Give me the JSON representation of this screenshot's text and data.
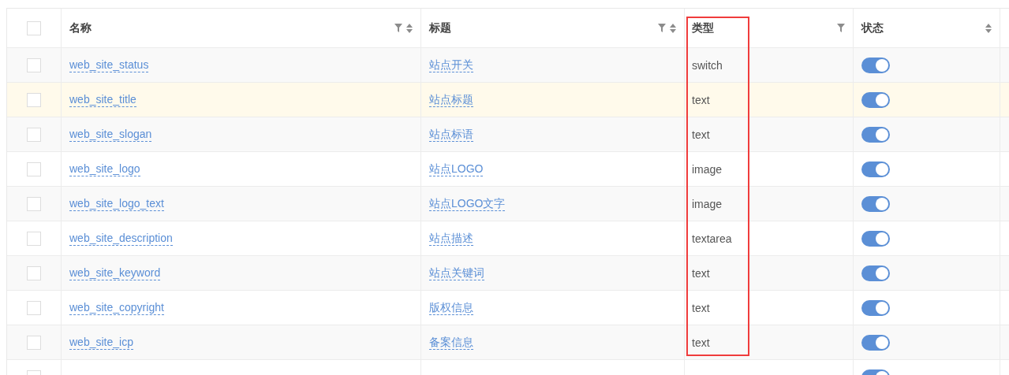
{
  "table": {
    "columns": [
      {
        "label": "名称",
        "filter": true,
        "sort": true,
        "highlighted": false
      },
      {
        "label": "标题",
        "filter": true,
        "sort": true,
        "highlighted": false
      },
      {
        "label": "类型",
        "filter": true,
        "sort": false,
        "highlighted": true
      },
      {
        "label": "状态",
        "filter": false,
        "sort": true,
        "highlighted": false
      }
    ],
    "rows": [
      {
        "checked": false,
        "hovered": false,
        "name": "web_site_status",
        "title": "站点开关",
        "type": "switch",
        "on": true
      },
      {
        "checked": false,
        "hovered": true,
        "name": "web_site_title",
        "title": "站点标题",
        "type": "text",
        "on": true
      },
      {
        "checked": false,
        "hovered": false,
        "name": "web_site_slogan",
        "title": "站点标语",
        "type": "text",
        "on": true
      },
      {
        "checked": false,
        "hovered": false,
        "name": "web_site_logo",
        "title": "站点LOGO",
        "type": "image",
        "on": true
      },
      {
        "checked": false,
        "hovered": false,
        "name": "web_site_logo_text",
        "title": "站点LOGO文字",
        "type": "image",
        "on": true
      },
      {
        "checked": false,
        "hovered": false,
        "name": "web_site_description",
        "title": "站点描述",
        "type": "textarea",
        "on": true
      },
      {
        "checked": false,
        "hovered": false,
        "name": "web_site_keyword",
        "title": "站点关键词",
        "type": "text",
        "on": true
      },
      {
        "checked": false,
        "hovered": false,
        "name": "web_site_copyright",
        "title": "版权信息",
        "type": "text",
        "on": true
      },
      {
        "checked": false,
        "hovered": false,
        "name": "web_site_icp",
        "title": "备案信息",
        "type": "text",
        "on": true
      },
      {
        "checked": false,
        "hovered": false,
        "on": true
      }
    ],
    "select_all": {
      "checked": false
    }
  }
}
